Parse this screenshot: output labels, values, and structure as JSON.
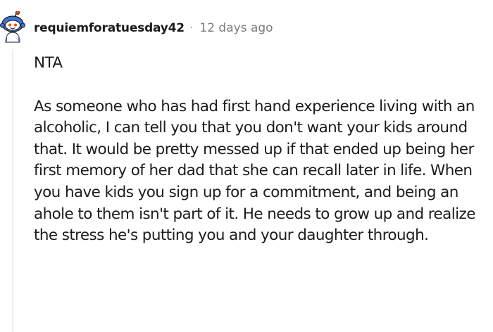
{
  "comment": {
    "author": "requiemforatuesday42",
    "separator": "·",
    "time_ago": "12 days ago",
    "verdict": "NTA",
    "body": "As someone who has had first hand experience living with an alcoholic, I can tell you that you don't want your kids around that. It would be pretty messed up if that ended up being her first memory of her dad that she can recall later in life. When you have kids you sign up for a commitment, and being an ahole to them isn't part of it. He needs to grow up and realize the stress he's putting you and your daughter through."
  },
  "avatar": {
    "icon": "snoo-avatar-icon",
    "colors": {
      "helmet": "#3f74d9",
      "face": "#ffffff",
      "antenna_tip": "#ff4500",
      "ink": "#1a1a1b"
    }
  },
  "colors": {
    "text": "#1c1c1c",
    "meta_text": "#7c7c7c",
    "thread_line": "#edeff1"
  }
}
